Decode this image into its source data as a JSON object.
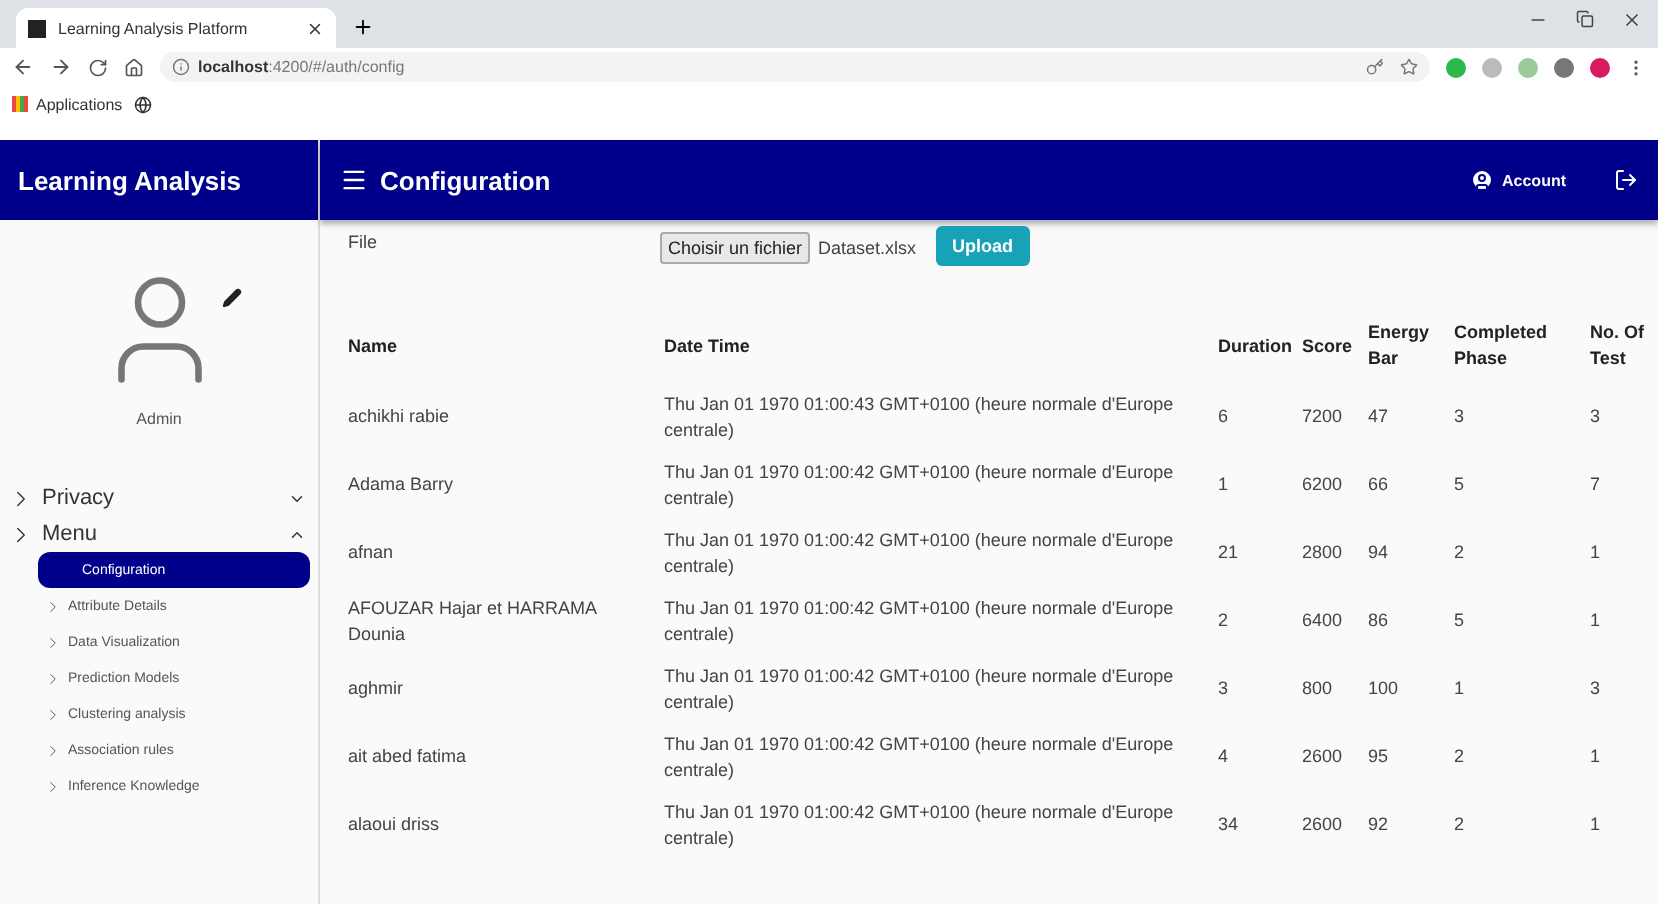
{
  "browser": {
    "tab_title": "Learning Analysis Platform",
    "url_host": "localhost",
    "url_path": ":4200/#/auth/config",
    "bookmarks": [
      "Applications"
    ]
  },
  "app": {
    "title": "Learning Analysis",
    "page_title": "Configuration",
    "account": "Account"
  },
  "sidebar": {
    "user": "Admin",
    "groups": [
      {
        "label": "Privacy",
        "expanded": false
      },
      {
        "label": "Menu",
        "expanded": true,
        "children": [
          {
            "label": "Configuration",
            "selected": true
          },
          {
            "label": "Attribute Details",
            "selected": false
          },
          {
            "label": "Data Visualization",
            "selected": false
          },
          {
            "label": "Prediction Models",
            "selected": false
          },
          {
            "label": "Clustering analysis",
            "selected": false
          },
          {
            "label": "Association rules",
            "selected": false
          },
          {
            "label": "Inference Knowledge",
            "selected": false
          }
        ]
      }
    ]
  },
  "file": {
    "label": "File",
    "choose_button": "Choisir un fichier",
    "file_name": "Dataset.xlsx",
    "upload_button": "Upload"
  },
  "table": {
    "columns": [
      "Name",
      "Date Time",
      "Duration",
      "Score",
      "Energy Bar",
      "Completed Phase",
      "No. Of Test"
    ],
    "rows": [
      [
        "achikhi rabie",
        "Thu Jan 01 1970 01:00:43 GMT+0100 (heure normale d'Europe centrale)",
        "6",
        "7200",
        "47",
        "3",
        "3"
      ],
      [
        "Adama Barry",
        "Thu Jan 01 1970 01:00:42 GMT+0100 (heure normale d'Europe centrale)",
        "1",
        "6200",
        "66",
        "5",
        "7"
      ],
      [
        "afnan",
        "Thu Jan 01 1970 01:00:42 GMT+0100 (heure normale d'Europe centrale)",
        "21",
        "2800",
        "94",
        "2",
        "1"
      ],
      [
        "AFOUZAR Hajar et HARRAMA Dounia",
        "Thu Jan 01 1970 01:00:42 GMT+0100 (heure normale d'Europe centrale)",
        "2",
        "6400",
        "86",
        "5",
        "1"
      ],
      [
        "aghmir",
        "Thu Jan 01 1970 01:00:42 GMT+0100 (heure normale d'Europe centrale)",
        "3",
        "800",
        "100",
        "1",
        "3"
      ],
      [
        "ait abed fatima",
        "Thu Jan 01 1970 01:00:42 GMT+0100 (heure normale d'Europe centrale)",
        "4",
        "2600",
        "95",
        "2",
        "1"
      ],
      [
        "alaoui driss",
        "Thu Jan 01 1970 01:00:42 GMT+0100 (heure normale d'Europe centrale)",
        "34",
        "2600",
        "92",
        "2",
        "1"
      ]
    ]
  }
}
